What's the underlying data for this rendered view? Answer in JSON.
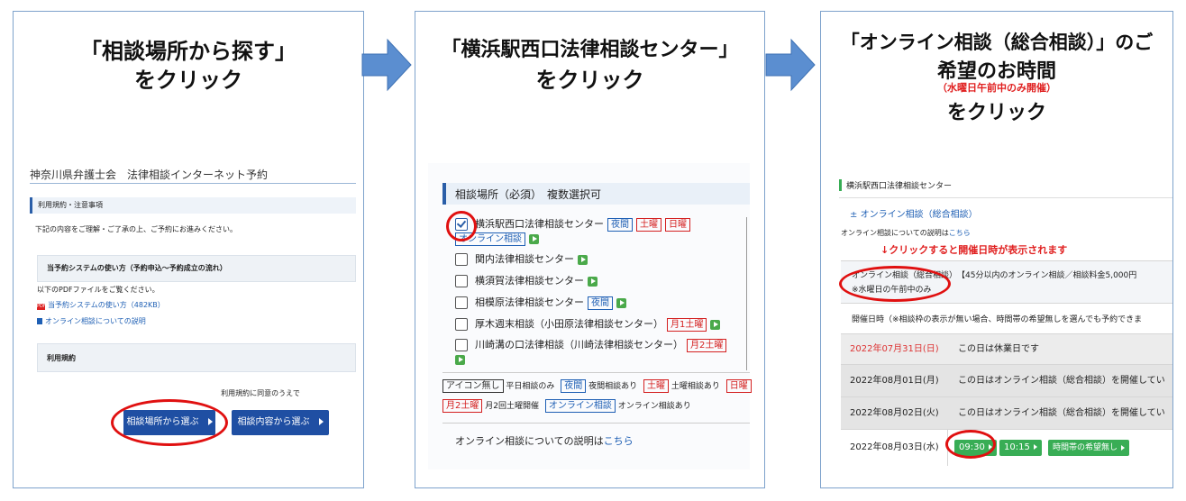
{
  "step1": {
    "heading_line1": "「相談場所から探す」",
    "heading_line2": "をクリック",
    "site_title": "神奈川県弁護士会　法律相談インターネット予約",
    "section_terms": "利用規約・注意事項",
    "intro_text": "下記の内容をご理解・ご了承の上、ご予約にお進みください。",
    "how_to_title": "当予約システムの使い方（予約申込～予約成立の流れ）",
    "pdf_note": "以下のPDFファイルをご覧ください。",
    "pdf_link": "当予約システムの使い方（482KB）",
    "online_link": "オンライン相談についての説明",
    "terms_title": "利用規約",
    "agree_text": "利用規約に同意のうえで",
    "btn_place": "相談場所から選ぶ",
    "btn_content": "相談内容から選ぶ"
  },
  "step2": {
    "heading_line1": "「横浜駅西口法律相談センター」",
    "heading_line2": "をクリック",
    "section_title": "相談場所（必須）　複数選択可",
    "items": [
      {
        "name": "横浜駅西口法律相談センター",
        "tags": [
          "夜間",
          "土曜",
          "日曜"
        ],
        "tag2": "オンライン相談"
      },
      {
        "name": "関内法律相談センター"
      },
      {
        "name": "横須賀法律相談センター"
      },
      {
        "name": "相模原法律相談センター",
        "tags": [
          "夜間"
        ]
      },
      {
        "name": "厚木週末相談（小田原法律相談センター）",
        "tags": [
          "月1土曜"
        ]
      },
      {
        "name": "川崎溝の口法律相談（川崎法律相談センター）",
        "tags": [
          "月2土曜"
        ]
      }
    ],
    "legend1_tag": "アイコン無し",
    "legend1_text": "平日相談のみ",
    "legend2_tag": "夜間",
    "legend2_text": "夜間相談あり",
    "legend3_tag": "土曜",
    "legend3_text": "土曜相談あり",
    "legend4_tag": "日曜",
    "legend5_tag": "月2土曜",
    "legend5_text": "月2回土曜開催",
    "legend6_tag": "オンライン相談",
    "legend6_text": "オンライン相談あり",
    "online_note": "オンライン相談についての説明は",
    "online_link": "こちら"
  },
  "step3": {
    "heading_line1": "「オンライン相談（総合相談）」のご",
    "heading_line2": "希望のお時間",
    "heading_sub": "（水曜日午前中のみ開催）",
    "heading_line3": "をクリック",
    "center_title": "横浜駅西口法律相談センター",
    "category": "オンライン相談（総合相談）",
    "online_note": "オンライン相談についての説明は",
    "online_link": "こちら",
    "callout": "↓クリックすると開催日時が表示されます",
    "info_line1a": "オンライン相談（総合相談）",
    "info_line1b": "【45分以内のオンライン相談／相談料金5,000円",
    "info_line2": "※水曜日の午前中のみ",
    "schedule_note": "開催日時（※相談枠の表示が無い場合、時間帯の希望無しを選んでも予約できま",
    "rows": [
      {
        "date": "2022年07月31日(日)",
        "text": "この日は休業日です"
      },
      {
        "date": "2022年08月01日(月)",
        "text": "この日はオンライン相談（総合相談）を開催してい"
      },
      {
        "date": "2022年08月02日(火)",
        "text": "この日はオンライン相談（総合相談）を開催してい"
      },
      {
        "date": "2022年08月03日(水)",
        "slots": [
          "09:30",
          "10:15",
          "時間帯の希望無し"
        ]
      }
    ]
  }
}
